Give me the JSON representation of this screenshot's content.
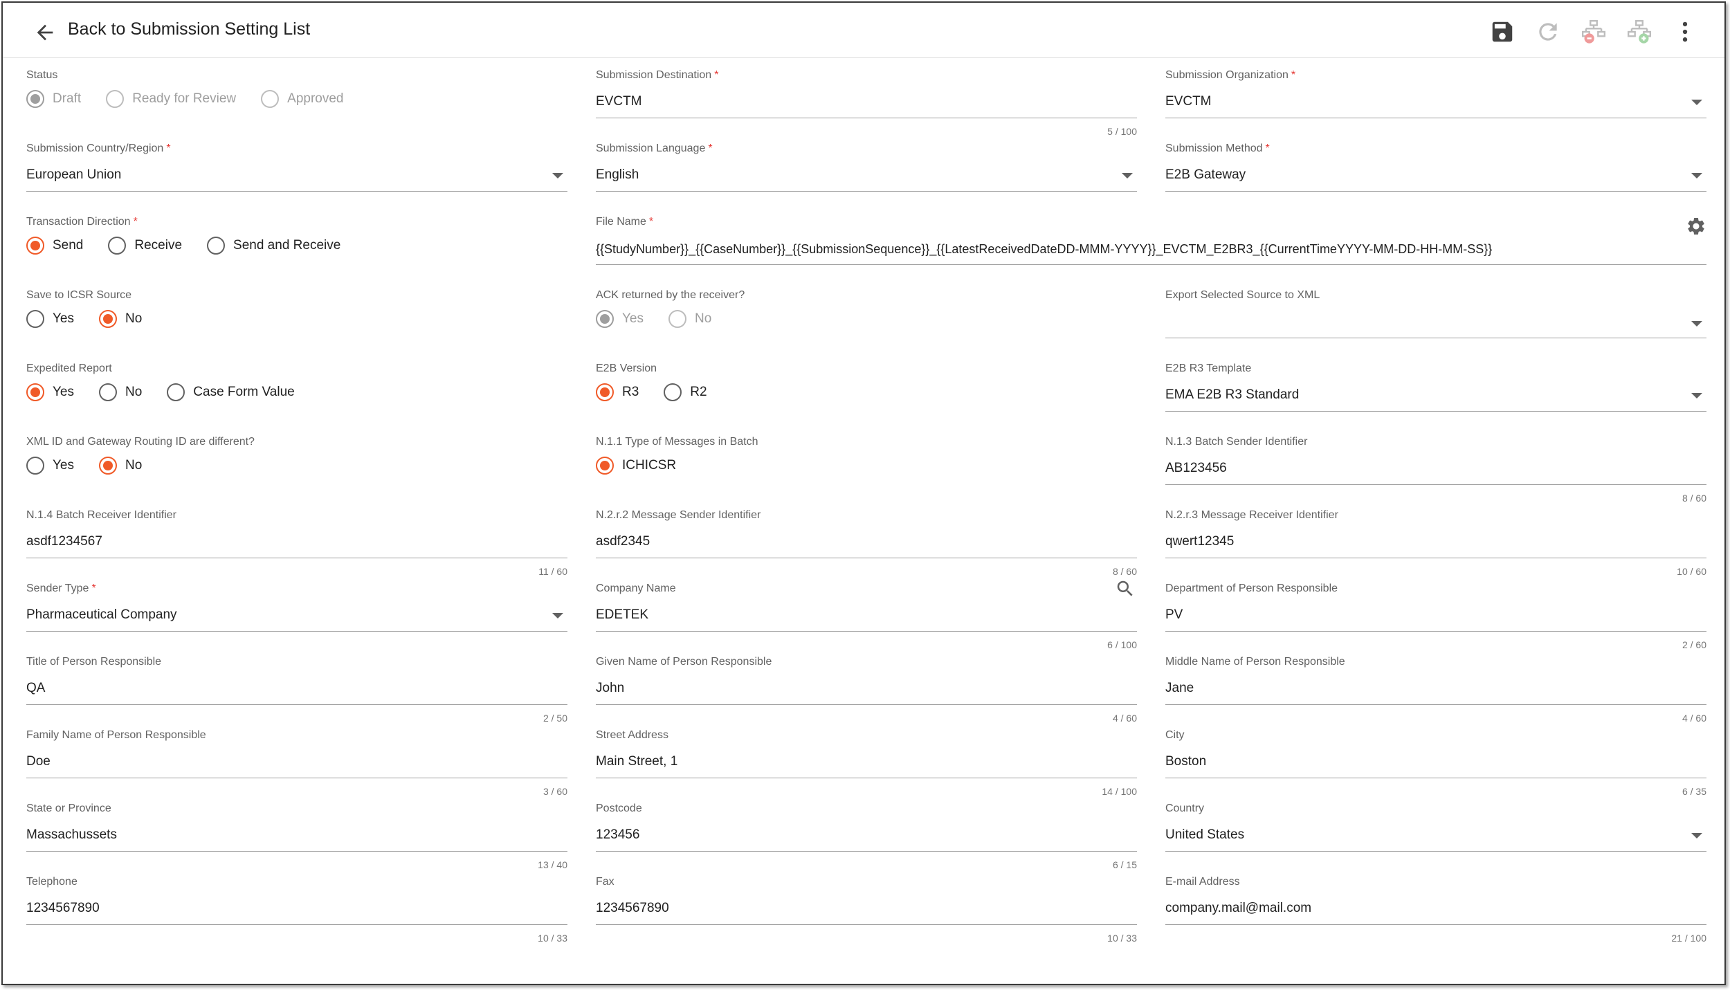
{
  "header": {
    "back_label": "Back to Submission Setting List",
    "icons": [
      "arrow-back-icon",
      "save-icon",
      "refresh-icon",
      "sitemap-remove-icon",
      "sitemap-add-icon",
      "more-vert-icon"
    ]
  },
  "colors": {
    "accent": "#f05a28",
    "required": "#e53935",
    "label": "#616161",
    "disabled": "#9e9e9e"
  },
  "form": {
    "status": {
      "label": "Status",
      "options": [
        "Draft",
        "Ready for Review",
        "Approved"
      ],
      "selected": "Draft",
      "disabled": true
    },
    "submission_destination": {
      "label": "Submission Destination",
      "value": "EVCTM",
      "counter": "5 / 100"
    },
    "submission_organization": {
      "label": "Submission Organization",
      "value": "EVCTM"
    },
    "submission_country": {
      "label": "Submission Country/Region",
      "value": "European Union"
    },
    "submission_language": {
      "label": "Submission Language",
      "value": "English"
    },
    "submission_method": {
      "label": "Submission Method",
      "value": "E2B Gateway"
    },
    "transaction_direction": {
      "label": "Transaction Direction",
      "options": [
        "Send",
        "Receive",
        "Send and Receive"
      ],
      "selected": "Send"
    },
    "file_name": {
      "label": "File Name",
      "value": "{{StudyNumber}}_{{CaseNumber}}_{{SubmissionSequence}}_{{LatestReceivedDateDD-MMM-YYYY}}_EVCTM_E2BR3_{{CurrentTimeYYYY-MM-DD-HH-MM-SS}}"
    },
    "save_to_icsr": {
      "label": "Save to ICSR Source",
      "options": [
        "Yes",
        "No"
      ],
      "selected": "No"
    },
    "ack_returned": {
      "label": "ACK returned by the receiver?",
      "options": [
        "Yes",
        "No"
      ],
      "selected": "Yes",
      "disabled": true
    },
    "export_source_xml": {
      "label": "Export Selected Source to XML",
      "value": ""
    },
    "expedited_report": {
      "label": "Expedited Report",
      "options": [
        "Yes",
        "No",
        "Case Form Value"
      ],
      "selected": "Yes"
    },
    "e2b_version": {
      "label": "E2B Version",
      "options": [
        "R3",
        "R2"
      ],
      "selected": "R3"
    },
    "e2b_r3_template": {
      "label": "E2B R3 Template",
      "value": "EMA E2B R3 Standard"
    },
    "xml_id_different": {
      "label": "XML ID and Gateway Routing ID are different?",
      "options": [
        "Yes",
        "No"
      ],
      "selected": "No"
    },
    "n11_type_messages": {
      "label": "N.1.1 Type of Messages in Batch",
      "options": [
        "ICHICSR"
      ],
      "selected": "ICHICSR"
    },
    "n13_batch_sender": {
      "label": "N.1.3 Batch Sender Identifier",
      "value": "AB123456",
      "counter": "8 / 60"
    },
    "n14_batch_receiver": {
      "label": "N.1.4 Batch Receiver Identifier",
      "value": "asdf1234567",
      "counter": "11 / 60"
    },
    "n2r2_message_sender": {
      "label": "N.2.r.2 Message Sender Identifier",
      "value": "asdf2345",
      "counter": "8 / 60"
    },
    "n2r3_message_receiver": {
      "label": "N.2.r.3 Message Receiver Identifier",
      "value": "qwert12345",
      "counter": "10 / 60"
    },
    "sender_type": {
      "label": "Sender Type",
      "value": "Pharmaceutical Company"
    },
    "company_name": {
      "label": "Company Name",
      "value": "EDETEK",
      "counter": "6 / 100"
    },
    "department": {
      "label": "Department of Person Responsible",
      "value": "PV",
      "counter": "2 / 60"
    },
    "title_person": {
      "label": "Title of Person Responsible",
      "value": "QA",
      "counter": "2 / 50"
    },
    "given_name": {
      "label": "Given Name of Person Responsible",
      "value": "John",
      "counter": "4 / 60"
    },
    "middle_name": {
      "label": "Middle Name of Person Responsible",
      "value": "Jane",
      "counter": "4 / 60"
    },
    "family_name": {
      "label": "Family Name of Person Responsible",
      "value": "Doe",
      "counter": "3 / 60"
    },
    "street_address": {
      "label": "Street Address",
      "value": "Main Street, 1",
      "counter": "14 / 100"
    },
    "city": {
      "label": "City",
      "value": "Boston",
      "counter": "6 / 35"
    },
    "state": {
      "label": "State or Province",
      "value": "Massachussets",
      "counter": "13 / 40"
    },
    "postcode": {
      "label": "Postcode",
      "value": "123456",
      "counter": "6 / 15"
    },
    "country": {
      "label": "Country",
      "value": "United States"
    },
    "telephone": {
      "label": "Telephone",
      "value": "1234567890",
      "counter": "10 / 33"
    },
    "fax": {
      "label": "Fax",
      "value": "1234567890",
      "counter": "10 / 33"
    },
    "email": {
      "label": "E-mail Address",
      "value": "company.mail@mail.com",
      "counter": "21 / 100"
    }
  }
}
